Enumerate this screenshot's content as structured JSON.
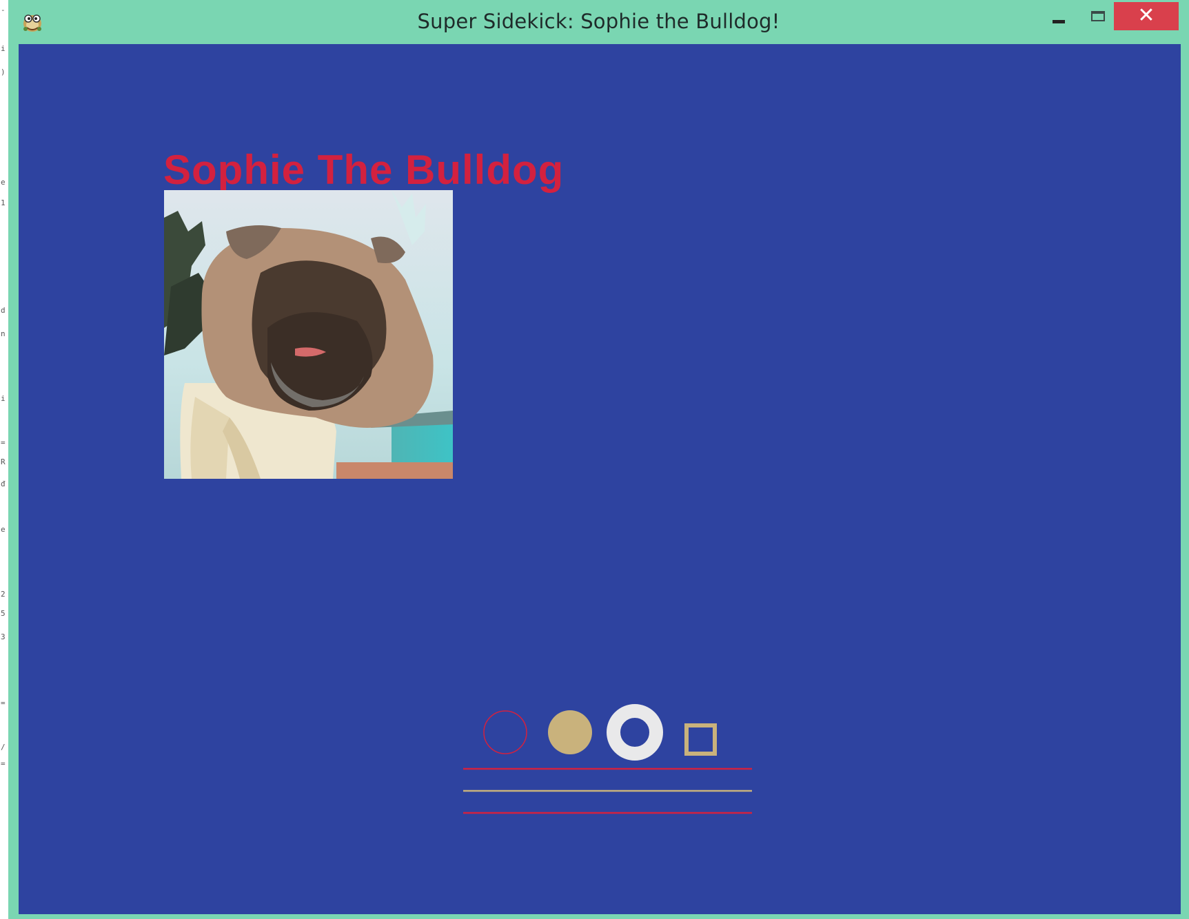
{
  "window": {
    "title": "Super Sidekick: Sophie the Bulldog!",
    "close_glyph": "✕",
    "titlebar_color": "#7ad6b2",
    "close_color": "#d9404c",
    "app_icon": "pygame-snake-icon"
  },
  "canvas": {
    "background": "#2e43a0",
    "heading": "Sophie The Bulldog",
    "heading_color": "#d3213f",
    "photo_subject": "bulldog-photo"
  },
  "shapes": {
    "colors": {
      "red": "#d3213f",
      "tan": "#c9b27c",
      "white": "#e9e9ea"
    }
  },
  "gutter": {
    "marks": [
      "-",
      "i",
      ")",
      "e",
      "1",
      "d",
      "n",
      "i",
      "=",
      "R",
      "đ",
      "e",
      "2",
      "5",
      "3",
      "=",
      "/",
      "="
    ]
  }
}
